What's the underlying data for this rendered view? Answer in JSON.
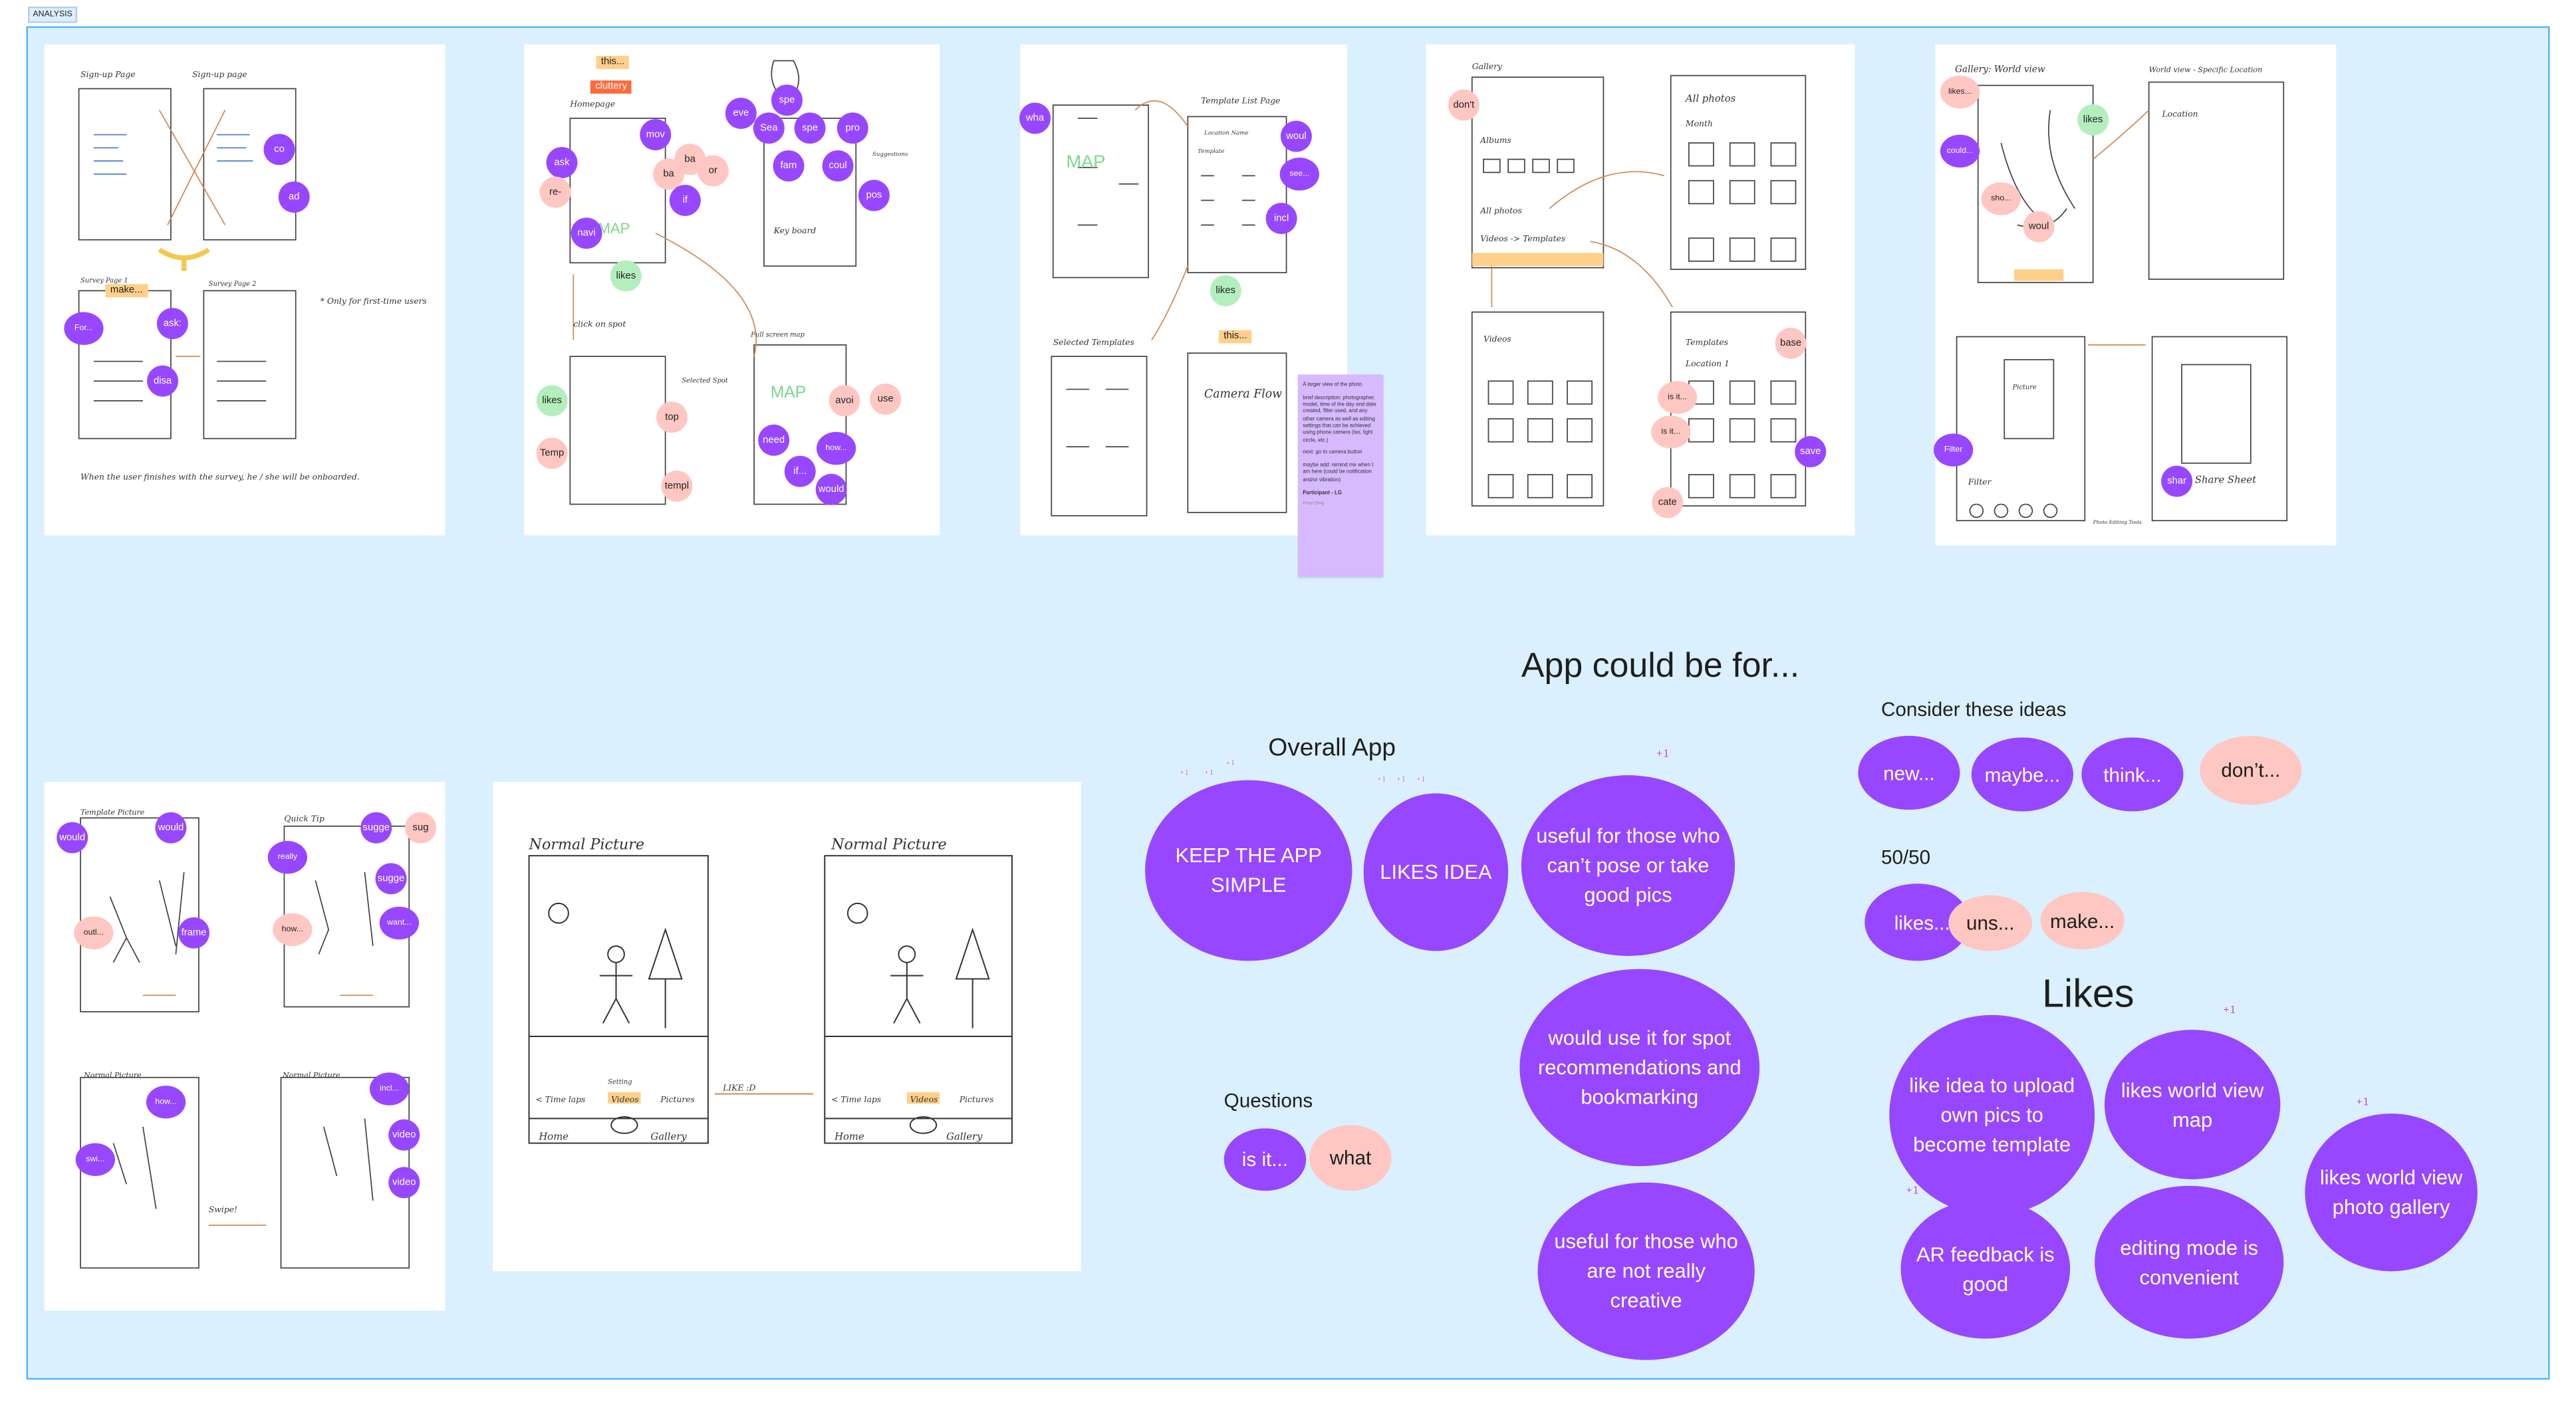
{
  "section_label": "ANALYSIS",
  "colors": {
    "background": "#daf0fe",
    "border": "#56b6f5",
    "purple": "#9747ff",
    "pink": "#ffc7c2",
    "green": "#b3efbd",
    "orange": "#ffd08a",
    "red": "#ff6a3a",
    "sticky": "#d6b9ff"
  },
  "frames": {
    "f1": {
      "titles": [
        "Sign-up Page",
        "Sign-up page",
        "Survey Page 1",
        "Survey Page 2",
        "* Only for first-time users",
        "When the user finishes with the survey, he / she will be onboarded."
      ]
    },
    "f2": {
      "titles": [
        "Homepage",
        "Key board",
        "click on spot",
        "Selected Spot",
        "Full screen map",
        "MAP",
        "MAP",
        "Suggestions"
      ]
    },
    "f3": {
      "titles": [
        "Template List Page",
        "MAP",
        "Selected Templates",
        "Camera Flow",
        "Location Name",
        "Template"
      ]
    },
    "f4": {
      "titles": [
        "Gallery",
        "Albums",
        "All photos",
        "Videos -> Templates",
        "All photos",
        "Month",
        "Videos",
        "Templates",
        "Location 1"
      ]
    },
    "f5": {
      "titles": [
        "Gallery: World view",
        "World view - Specific Location",
        "Location",
        "Picture",
        "Filter",
        "Share Sheet",
        "Photo Editing Tools"
      ]
    },
    "f6": {
      "titles": [
        "Template Picture",
        "Quick Tip",
        "Normal Picture",
        "Normal Picture",
        "Swipe!"
      ]
    },
    "f7": {
      "titles": [
        "Normal Picture",
        "Normal Picture",
        "LIKE :D",
        "< Time laps",
        "Videos",
        "Pictures",
        "Home",
        "Gallery",
        "Setting"
      ]
    }
  },
  "sticky_note": {
    "lines": [
      "A larger view of the photo",
      "brief description: photographer, model, time of the day and date created, filter used, and any other camera as well as editing settings that can be achieved using phone camera (iso, light circle, etc.)",
      "next: go to camera button",
      "maybe add: remind me when I am here (could be notification and/or vibration)"
    ],
    "participant": "Participant - LG",
    "author": "Fanyi Zeng"
  },
  "frame_stickers": [
    {
      "label": "co",
      "kind": "p"
    },
    {
      "label": "ad",
      "kind": "p"
    },
    {
      "label": "make...",
      "kind": "o-label"
    },
    {
      "label": "For...",
      "kind": "p"
    },
    {
      "label": "ask:",
      "kind": "p"
    },
    {
      "label": "disa",
      "kind": "p"
    },
    {
      "label": "this...",
      "kind": "o-label"
    },
    {
      "label": "cluttery",
      "kind": "r-label"
    },
    {
      "label": "spe",
      "kind": "p"
    },
    {
      "label": "eve",
      "kind": "p"
    },
    {
      "label": "Sea",
      "kind": "p"
    },
    {
      "label": "spe",
      "kind": "p"
    },
    {
      "label": "pro",
      "kind": "p"
    },
    {
      "label": "mov",
      "kind": "p"
    },
    {
      "label": "ask",
      "kind": "p"
    },
    {
      "label": "ba",
      "kind": "k"
    },
    {
      "label": "or",
      "kind": "k"
    },
    {
      "label": "ba",
      "kind": "k"
    },
    {
      "label": "fam",
      "kind": "p"
    },
    {
      "label": "coul",
      "kind": "p"
    },
    {
      "label": "re-",
      "kind": "k"
    },
    {
      "label": "pos",
      "kind": "p"
    },
    {
      "label": "if",
      "kind": "p"
    },
    {
      "label": "navi",
      "kind": "p"
    },
    {
      "label": "likes",
      "kind": "g"
    },
    {
      "label": "likes",
      "kind": "g"
    },
    {
      "label": "top",
      "kind": "k"
    },
    {
      "label": "Temp",
      "kind": "k"
    },
    {
      "label": "templ",
      "kind": "k"
    },
    {
      "label": "avoi",
      "kind": "k"
    },
    {
      "label": "use",
      "kind": "k"
    },
    {
      "label": "need",
      "kind": "p"
    },
    {
      "label": "how...",
      "kind": "p"
    },
    {
      "label": "if...",
      "kind": "p"
    },
    {
      "label": "would",
      "kind": "p"
    },
    {
      "label": "wha",
      "kind": "p"
    },
    {
      "label": "woul",
      "kind": "p"
    },
    {
      "label": "see...",
      "kind": "p"
    },
    {
      "label": "incl",
      "kind": "p"
    },
    {
      "label": "likes",
      "kind": "g"
    },
    {
      "label": "this...",
      "kind": "o-label"
    },
    {
      "label": "don't",
      "kind": "k"
    },
    {
      "label": "base",
      "kind": "k"
    },
    {
      "label": "is it...",
      "kind": "k"
    },
    {
      "label": "is it...",
      "kind": "k"
    },
    {
      "label": "save",
      "kind": "p"
    },
    {
      "label": "cate",
      "kind": "k"
    },
    {
      "label": "likes...",
      "kind": "k"
    },
    {
      "label": "likes",
      "kind": "g"
    },
    {
      "label": "could...",
      "kind": "p"
    },
    {
      "label": "sho...",
      "kind": "k"
    },
    {
      "label": "woul",
      "kind": "k"
    },
    {
      "label": "Filter",
      "kind": "p"
    },
    {
      "label": "shar",
      "kind": "p"
    },
    {
      "label": "would",
      "kind": "p"
    },
    {
      "label": "would",
      "kind": "p"
    },
    {
      "label": "sugge",
      "kind": "p"
    },
    {
      "label": "sug",
      "kind": "k"
    },
    {
      "label": "really",
      "kind": "p"
    },
    {
      "label": "sugge",
      "kind": "p"
    },
    {
      "label": "outl...",
      "kind": "k"
    },
    {
      "label": "frame",
      "kind": "p"
    },
    {
      "label": "how...",
      "kind": "k"
    },
    {
      "label": "want...",
      "kind": "p"
    },
    {
      "label": "how...",
      "kind": "p"
    },
    {
      "label": "incl...",
      "kind": "p"
    },
    {
      "label": "swi...",
      "kind": "p"
    },
    {
      "label": "video",
      "kind": "p"
    },
    {
      "label": "video",
      "kind": "p"
    }
  ],
  "headings": {
    "app_could_be_for": "App could be for...",
    "overall_app": "Overall App",
    "consider": "Consider these ideas",
    "fifty": "50/50",
    "questions": "Questions",
    "likes": "Likes"
  },
  "plus_one": "+1",
  "overall_app": [
    {
      "text": "KEEP THE APP SIMPLE",
      "votes": 3
    },
    {
      "text": "LIKES IDEA",
      "votes": 3
    },
    {
      "text": "useful for those who can’t pose or take good pics",
      "votes": 1
    },
    {
      "text": "would use it for spot recommendations and bookmarking",
      "votes": 0
    },
    {
      "text": "useful for those who are not really creative",
      "votes": 0
    }
  ],
  "questions": [
    {
      "text": "is it...",
      "kind": "p"
    },
    {
      "text": "what",
      "kind": "k"
    }
  ],
  "consider": [
    {
      "text": "new...",
      "kind": "p"
    },
    {
      "text": "maybe...",
      "kind": "p"
    },
    {
      "text": "think...",
      "kind": "p"
    },
    {
      "text": "don’t...",
      "kind": "k"
    }
  ],
  "fifty_fifty": [
    {
      "text": "likes...",
      "kind": "p"
    },
    {
      "text": "uns...",
      "kind": "k"
    },
    {
      "text": "make...",
      "kind": "k"
    }
  ],
  "likes": [
    {
      "text": "like idea to upload own pics to become template",
      "votes": 0
    },
    {
      "text": "likes world view map",
      "votes": 1
    },
    {
      "text": "AR feedback is good",
      "votes": 1
    },
    {
      "text": "editing mode is convenient",
      "votes": 0
    },
    {
      "text": "likes world view photo gallery",
      "votes": 1
    }
  ]
}
